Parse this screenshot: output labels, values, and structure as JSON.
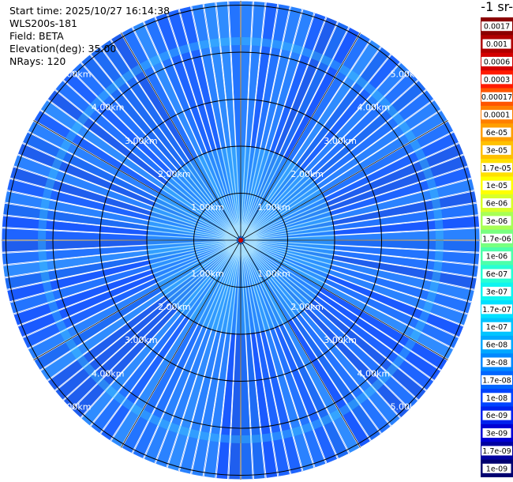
{
  "header": {
    "start_time": "Start time: 2025/10/27 16:14:38",
    "instrument": "WLS200s-181",
    "field": "Field: BETA",
    "elevation": "Elevation(deg): 35.00",
    "nrays": "NRays: 120"
  },
  "colorbar": {
    "title": "-1 sr-",
    "ticks": [
      {
        "label": "0.0017",
        "color": "#8b0000"
      },
      {
        "label": "0.001",
        "color": "#b00000"
      },
      {
        "label": "0.0006",
        "color": "#d40000"
      },
      {
        "label": "0.0003",
        "color": "#ff1a00"
      },
      {
        "label": "0.00017",
        "color": "#ff5500"
      },
      {
        "label": "0.0001",
        "color": "#ff7f00"
      },
      {
        "label": "6e-05",
        "color": "#ff9f00"
      },
      {
        "label": "3e-05",
        "color": "#ffc000"
      },
      {
        "label": "1.7e-05",
        "color": "#ffe000"
      },
      {
        "label": "1e-05",
        "color": "#ffff00"
      },
      {
        "label": "6e-06",
        "color": "#d8ff2a"
      },
      {
        "label": "3e-06",
        "color": "#a8ff55"
      },
      {
        "label": "1.7e-06",
        "color": "#78ff80"
      },
      {
        "label": "1e-06",
        "color": "#4dffaa"
      },
      {
        "label": "6e-07",
        "color": "#28ffd4"
      },
      {
        "label": "3e-07",
        "color": "#10f5f0"
      },
      {
        "label": "1.7e-07",
        "color": "#00e0ff"
      },
      {
        "label": "1e-07",
        "color": "#00c4ff"
      },
      {
        "label": "6e-08",
        "color": "#00a8ff"
      },
      {
        "label": "3e-08",
        "color": "#0088ff"
      },
      {
        "label": "1.7e-08",
        "color": "#0066ff"
      },
      {
        "label": "1e-08",
        "color": "#0044ff"
      },
      {
        "label": "6e-09",
        "color": "#0022ee"
      },
      {
        "label": "3e-09",
        "color": "#0000d4"
      },
      {
        "label": "1.7e-09",
        "color": "#0000a0"
      },
      {
        "label": "1e-09",
        "color": "#000070"
      }
    ]
  },
  "range_labels": {
    "r1": "1.00km",
    "r2": "2.00km",
    "r3": "3.00km",
    "r4": "4.00km",
    "r5": "5.00km"
  },
  "plot": {
    "background_color": "#1e64ff",
    "near_color": "#38b6ff",
    "ring_color": "#000000"
  }
}
